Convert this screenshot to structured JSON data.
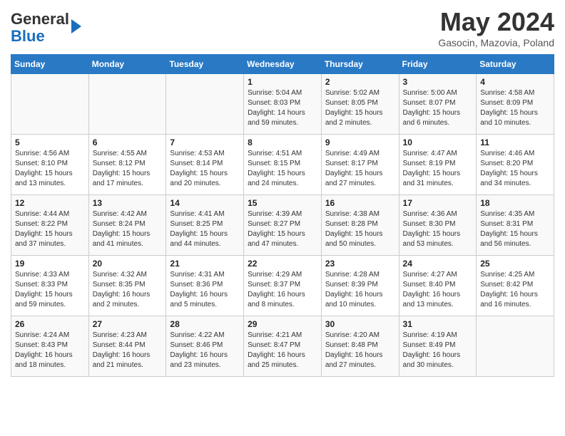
{
  "header": {
    "logo": {
      "line1": "General",
      "line2": "Blue"
    },
    "title": "May 2024",
    "subtitle": "Gasocin, Mazovia, Poland"
  },
  "days_of_week": [
    "Sunday",
    "Monday",
    "Tuesday",
    "Wednesday",
    "Thursday",
    "Friday",
    "Saturday"
  ],
  "weeks": [
    [
      {
        "day": "",
        "info": ""
      },
      {
        "day": "",
        "info": ""
      },
      {
        "day": "",
        "info": ""
      },
      {
        "day": "1",
        "info": "Sunrise: 5:04 AM\nSunset: 8:03 PM\nDaylight: 14 hours\nand 59 minutes."
      },
      {
        "day": "2",
        "info": "Sunrise: 5:02 AM\nSunset: 8:05 PM\nDaylight: 15 hours\nand 2 minutes."
      },
      {
        "day": "3",
        "info": "Sunrise: 5:00 AM\nSunset: 8:07 PM\nDaylight: 15 hours\nand 6 minutes."
      },
      {
        "day": "4",
        "info": "Sunrise: 4:58 AM\nSunset: 8:09 PM\nDaylight: 15 hours\nand 10 minutes."
      }
    ],
    [
      {
        "day": "5",
        "info": "Sunrise: 4:56 AM\nSunset: 8:10 PM\nDaylight: 15 hours\nand 13 minutes."
      },
      {
        "day": "6",
        "info": "Sunrise: 4:55 AM\nSunset: 8:12 PM\nDaylight: 15 hours\nand 17 minutes."
      },
      {
        "day": "7",
        "info": "Sunrise: 4:53 AM\nSunset: 8:14 PM\nDaylight: 15 hours\nand 20 minutes."
      },
      {
        "day": "8",
        "info": "Sunrise: 4:51 AM\nSunset: 8:15 PM\nDaylight: 15 hours\nand 24 minutes."
      },
      {
        "day": "9",
        "info": "Sunrise: 4:49 AM\nSunset: 8:17 PM\nDaylight: 15 hours\nand 27 minutes."
      },
      {
        "day": "10",
        "info": "Sunrise: 4:47 AM\nSunset: 8:19 PM\nDaylight: 15 hours\nand 31 minutes."
      },
      {
        "day": "11",
        "info": "Sunrise: 4:46 AM\nSunset: 8:20 PM\nDaylight: 15 hours\nand 34 minutes."
      }
    ],
    [
      {
        "day": "12",
        "info": "Sunrise: 4:44 AM\nSunset: 8:22 PM\nDaylight: 15 hours\nand 37 minutes."
      },
      {
        "day": "13",
        "info": "Sunrise: 4:42 AM\nSunset: 8:24 PM\nDaylight: 15 hours\nand 41 minutes."
      },
      {
        "day": "14",
        "info": "Sunrise: 4:41 AM\nSunset: 8:25 PM\nDaylight: 15 hours\nand 44 minutes."
      },
      {
        "day": "15",
        "info": "Sunrise: 4:39 AM\nSunset: 8:27 PM\nDaylight: 15 hours\nand 47 minutes."
      },
      {
        "day": "16",
        "info": "Sunrise: 4:38 AM\nSunset: 8:28 PM\nDaylight: 15 hours\nand 50 minutes."
      },
      {
        "day": "17",
        "info": "Sunrise: 4:36 AM\nSunset: 8:30 PM\nDaylight: 15 hours\nand 53 minutes."
      },
      {
        "day": "18",
        "info": "Sunrise: 4:35 AM\nSunset: 8:31 PM\nDaylight: 15 hours\nand 56 minutes."
      }
    ],
    [
      {
        "day": "19",
        "info": "Sunrise: 4:33 AM\nSunset: 8:33 PM\nDaylight: 15 hours\nand 59 minutes."
      },
      {
        "day": "20",
        "info": "Sunrise: 4:32 AM\nSunset: 8:35 PM\nDaylight: 16 hours\nand 2 minutes."
      },
      {
        "day": "21",
        "info": "Sunrise: 4:31 AM\nSunset: 8:36 PM\nDaylight: 16 hours\nand 5 minutes."
      },
      {
        "day": "22",
        "info": "Sunrise: 4:29 AM\nSunset: 8:37 PM\nDaylight: 16 hours\nand 8 minutes."
      },
      {
        "day": "23",
        "info": "Sunrise: 4:28 AM\nSunset: 8:39 PM\nDaylight: 16 hours\nand 10 minutes."
      },
      {
        "day": "24",
        "info": "Sunrise: 4:27 AM\nSunset: 8:40 PM\nDaylight: 16 hours\nand 13 minutes."
      },
      {
        "day": "25",
        "info": "Sunrise: 4:25 AM\nSunset: 8:42 PM\nDaylight: 16 hours\nand 16 minutes."
      }
    ],
    [
      {
        "day": "26",
        "info": "Sunrise: 4:24 AM\nSunset: 8:43 PM\nDaylight: 16 hours\nand 18 minutes."
      },
      {
        "day": "27",
        "info": "Sunrise: 4:23 AM\nSunset: 8:44 PM\nDaylight: 16 hours\nand 21 minutes."
      },
      {
        "day": "28",
        "info": "Sunrise: 4:22 AM\nSunset: 8:46 PM\nDaylight: 16 hours\nand 23 minutes."
      },
      {
        "day": "29",
        "info": "Sunrise: 4:21 AM\nSunset: 8:47 PM\nDaylight: 16 hours\nand 25 minutes."
      },
      {
        "day": "30",
        "info": "Sunrise: 4:20 AM\nSunset: 8:48 PM\nDaylight: 16 hours\nand 27 minutes."
      },
      {
        "day": "31",
        "info": "Sunrise: 4:19 AM\nSunset: 8:49 PM\nDaylight: 16 hours\nand 30 minutes."
      },
      {
        "day": "",
        "info": ""
      }
    ]
  ]
}
